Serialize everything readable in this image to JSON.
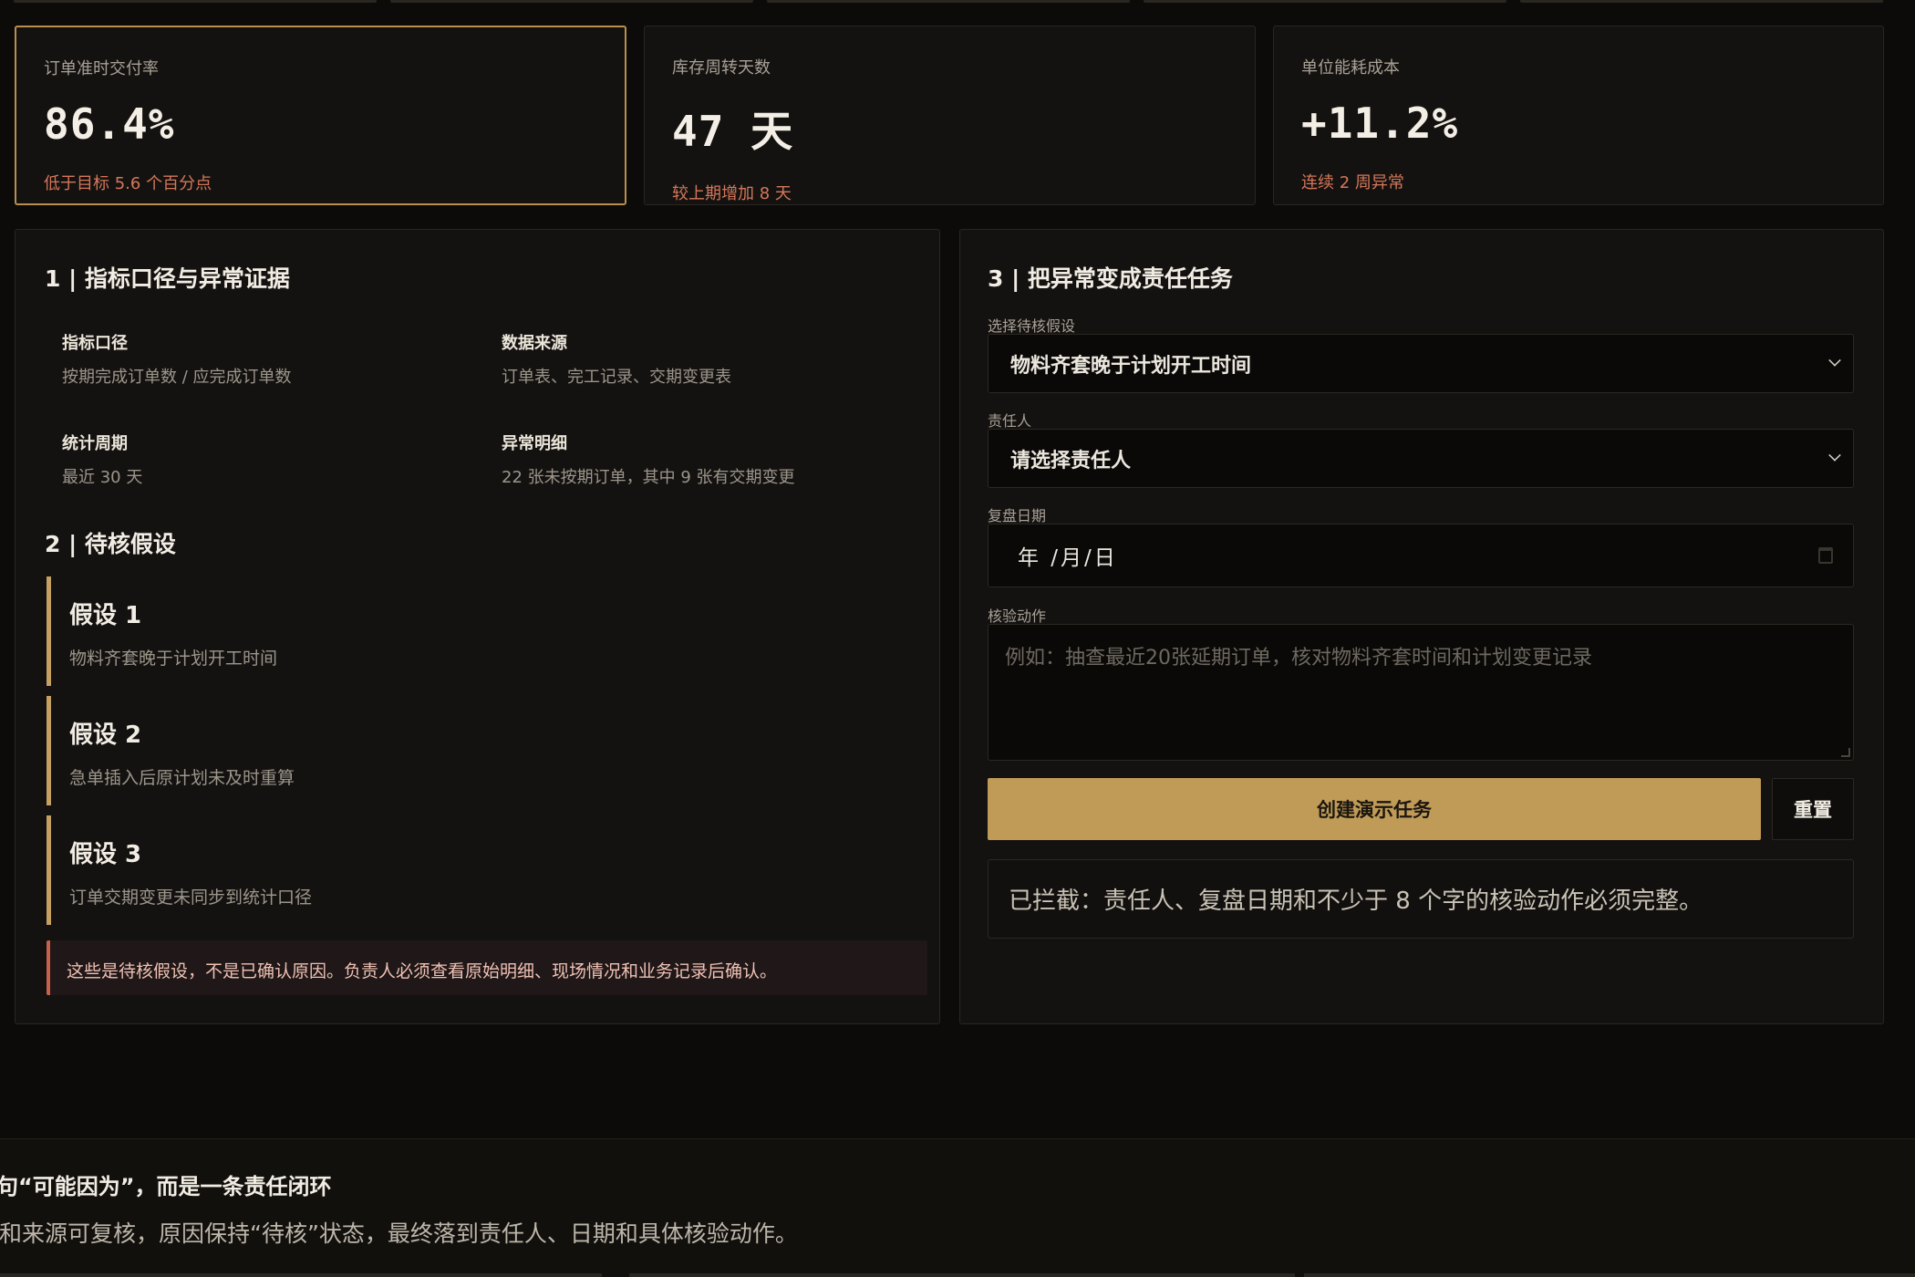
{
  "kpis": [
    {
      "label": "订单准时交付率",
      "value": "86.4%",
      "note": "低于目标 5.6 个百分点",
      "active": true
    },
    {
      "label": "库存周转天数",
      "value": "47 天",
      "note": "较上期增加 8 天",
      "active": false
    },
    {
      "label": "单位能耗成本",
      "value": "+11.2%",
      "note": "连续 2 周异常",
      "active": false
    }
  ],
  "evidence": {
    "title": "1 | 指标口径与异常证据",
    "items": [
      {
        "key": "指标口径",
        "value": "按期完成订单数 / 应完成订单数"
      },
      {
        "key": "数据来源",
        "value": "订单表、完工记录、交期变更表"
      },
      {
        "key": "统计周期",
        "value": "最近 30 天"
      },
      {
        "key": "异常明细",
        "value": "22 张未按期订单，其中 9 张有交期变更"
      }
    ]
  },
  "hypotheses": {
    "title": "2 | 待核假设",
    "items": [
      {
        "title": "假设 1",
        "desc": "物料齐套晚于计划开工时间"
      },
      {
        "title": "假设 2",
        "desc": "急单插入后原计划未及时重算"
      },
      {
        "title": "假设 3",
        "desc": "订单交期变更未同步到统计口径"
      }
    ],
    "warning": "这些是待核假设，不是已确认原因。负责人必须查看原始明细、现场情况和业务记录后确认。"
  },
  "task_form": {
    "title": "3 | 把异常变成责任任务",
    "hypothesis_label": "选择待核假设",
    "hypothesis_value": "物料齐套晚于计划开工时间",
    "owner_label": "责任人",
    "owner_value": "请选择责任人",
    "date_label": "复盘日期",
    "date_value": "年 /月/日",
    "action_label": "核验动作",
    "action_placeholder": "例如：抽查最近20张延期订单，核对物料齐套时间和计划变更记录",
    "create_button": "创建演示任务",
    "reset_button": "重置",
    "status": "已拦截：责任人、复盘日期和不少于 8 个字的核验动作必须完整。"
  },
  "footer": {
    "title": "一句“可能因为”，而是一条责任闭环",
    "text": "会和来源可复核，原因保持“待核”状态，最终落到责任人、日期和具体核验动作。"
  },
  "colors": {
    "accent": "#c09b57",
    "alert": "#d4775a",
    "background": "#0c0b0a",
    "panel": "#141210"
  }
}
